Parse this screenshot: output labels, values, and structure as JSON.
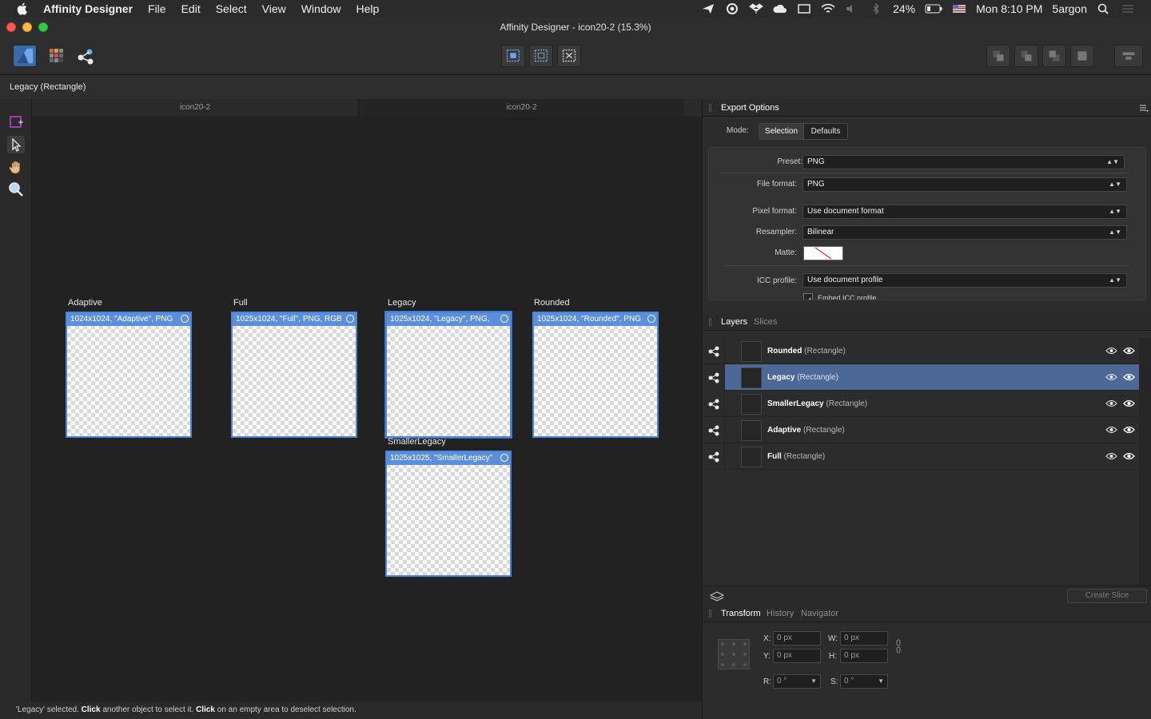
{
  "menubar": {
    "app_name": "Affinity Designer",
    "items": [
      "File",
      "Edit",
      "Select",
      "View",
      "Window",
      "Help"
    ],
    "battery": "24%",
    "clock": "Mon 8:10 PM",
    "user": "5argon"
  },
  "window": {
    "title": "Affinity Designer - icon20-2 (15.3%)"
  },
  "context": {
    "selection_label": "Legacy (Rectangle)"
  },
  "doc_tabs": [
    "icon20-2",
    "icon20-2"
  ],
  "artboards": [
    {
      "label": "Adaptive",
      "slice": "1024x1024, \"Adaptive\", PNG"
    },
    {
      "label": "Full",
      "slice": "1025x1024, \"Full\", PNG, RGB"
    },
    {
      "label": "Legacy",
      "slice": "1025x1024, \"Legacy\", PNG,"
    },
    {
      "label": "Rounded",
      "slice": "1025x1024, \"Rounded\", PNG"
    },
    {
      "label": "SmallerLegacy",
      "slice": "1025x1025, \"SmallerLegacy\""
    }
  ],
  "export": {
    "panel_title": "Export Options",
    "mode_label": "Mode:",
    "mode_selection": "Selection",
    "mode_defaults": "Defaults",
    "preset_label": "Preset:",
    "preset_value": "PNG",
    "format_label": "File format:",
    "format_value": "PNG",
    "pixel_label": "Pixel format:",
    "pixel_value": "Use document format",
    "resampler_label": "Resampler:",
    "resampler_value": "Bilinear",
    "matte_label": "Matte:",
    "icc_label": "ICC profile:",
    "icc_value": "Use document profile",
    "embed_label": "Embed ICC profile"
  },
  "layers_panel": {
    "tab_layers": "Layers",
    "tab_slices": "Slices",
    "rows": [
      {
        "name": "Rounded",
        "type": "(Rectangle)"
      },
      {
        "name": "Legacy",
        "type": "(Rectangle)"
      },
      {
        "name": "SmallerLegacy",
        "type": "(Rectangle)"
      },
      {
        "name": "Adaptive",
        "type": "(Rectangle)"
      },
      {
        "name": "Full",
        "type": "(Rectangle)"
      }
    ],
    "create_slice": "Create Slice"
  },
  "transform": {
    "tab_transform": "Transform",
    "tab_history": "History",
    "tab_navigator": "Navigator",
    "x_label": "X:",
    "x_value": "0 px",
    "y_label": "Y:",
    "y_value": "0 px",
    "w_label": "W:",
    "w_value": "0 px",
    "h_label": "H:",
    "h_value": "0 px",
    "r_label": "R:",
    "r_value": "0 °",
    "s_label": "S:",
    "s_value": "0 °"
  },
  "status": {
    "part1": "'Legacy' selected. ",
    "click1": "Click",
    "part2": " another object to select it. ",
    "click2": "Click",
    "part3": " on an empty area to deselect selection."
  },
  "colors": {
    "selection_blue": "#4b6896",
    "slice_blue": "#5b8fdb",
    "accent_magenta": "#b93fd6"
  }
}
